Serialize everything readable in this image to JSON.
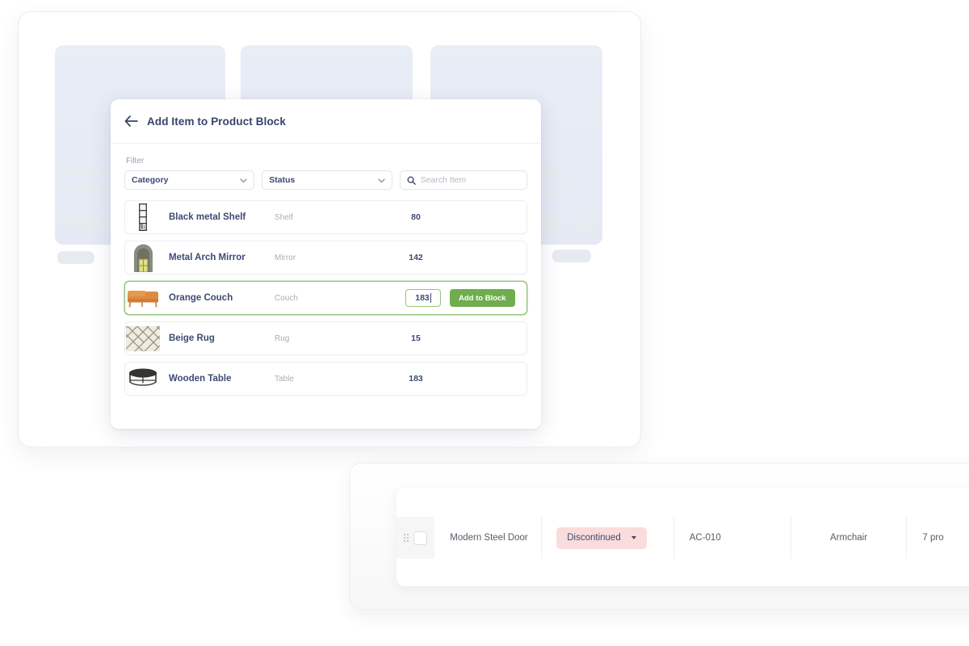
{
  "background_card": {
    "placeholder_blocks": 3,
    "skeleton_left_bars": 4,
    "skeleton_right_bars": 5
  },
  "modal": {
    "back_icon": "arrow-left-icon",
    "title": "Add Item to Product Block",
    "filter": {
      "label": "Filter",
      "category_select": {
        "value": "Category",
        "chevron": "chevron-down-icon"
      },
      "status_select": {
        "value": "Status",
        "chevron": "chevron-down-icon"
      },
      "search": {
        "icon": "search-icon",
        "placeholder": "Search Item",
        "value": ""
      }
    },
    "items": [
      {
        "thumb": "shelf-thumbnail",
        "name": "Black metal Shelf",
        "category": "Shelf",
        "qty": "80",
        "active": false
      },
      {
        "thumb": "mirror-thumbnail",
        "name": "Metal Arch Mirror",
        "category": "Mirror",
        "qty": "142",
        "active": false
      },
      {
        "thumb": "couch-thumbnail",
        "name": "Orange Couch",
        "category": "Couch",
        "qty": "183",
        "active": true,
        "add_button_label": "Add to Block"
      },
      {
        "thumb": "rug-thumbnail",
        "name": "Beige Rug",
        "category": "Rug",
        "qty": "15",
        "active": false
      },
      {
        "thumb": "table-thumbnail",
        "name": "Wooden Table",
        "category": "Table",
        "qty": "183",
        "active": false
      }
    ]
  },
  "bottom_card": {
    "row": {
      "drag_handle": "drag-handle-icon",
      "checkbox_checked": false,
      "product_name": "Modern Steel Door",
      "status": {
        "label": "Discontinued",
        "color": "#fadcdc",
        "caret": "caret-down-icon"
      },
      "sku": "AC-010",
      "type": "Armchair",
      "products": "7 pro"
    }
  },
  "colors": {
    "accent_green": "#6fad4e",
    "navy_text": "#3d4a72",
    "status_pink": "#fadcdc",
    "block_blue": "#e9edf6"
  }
}
